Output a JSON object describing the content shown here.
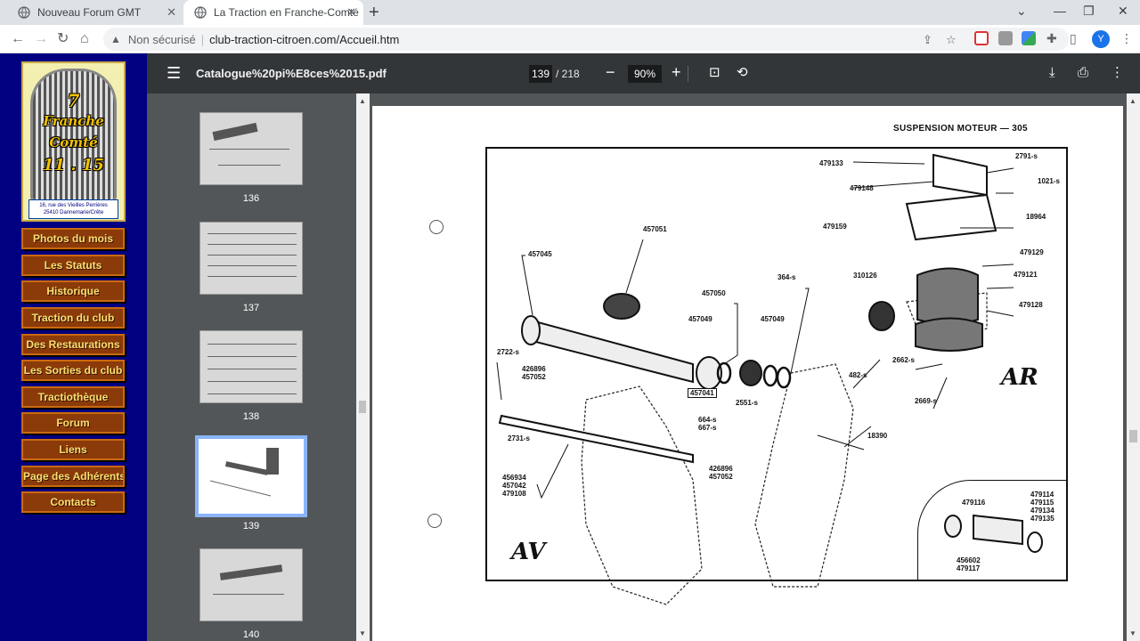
{
  "browser": {
    "tabs": [
      {
        "title": "Nouveau Forum GMT",
        "active": false
      },
      {
        "title": "La Traction en Franche-Comté",
        "active": true
      }
    ],
    "security_label": "Non sécurisé",
    "url": "club-traction-citroen.com/Accueil.htm",
    "profile_initial": "Y"
  },
  "site": {
    "logo": {
      "line1": "7",
      "line2": "Franche",
      "line3": "Comté",
      "line4": "11 . 15",
      "address1": "16, rue des Vieilles Perrières",
      "address2": "25410 Dannemarie/Crête"
    },
    "menu": [
      "Photos du mois",
      "Les Statuts",
      "Historique",
      "Traction du club",
      "Des Restaurations",
      "Les Sorties du club",
      "Tractiothèque",
      "Forum",
      "Liens",
      "Page des Adhérents",
      "Contacts"
    ],
    "colors": {
      "background": "#000080",
      "button": "#8b3a0a",
      "button_text": "#f7e070"
    }
  },
  "pdf": {
    "filename": "Catalogue%20pi%E8ces%2015.pdf",
    "current_page": "139",
    "total_pages": "/ 218",
    "zoom": "90%",
    "thumbnails": [
      {
        "page": "136",
        "selected": false
      },
      {
        "page": "137",
        "selected": false
      },
      {
        "page": "138",
        "selected": false
      },
      {
        "page": "139",
        "selected": true
      },
      {
        "page": "140",
        "selected": false
      }
    ],
    "page_content": {
      "header": "SUSPENSION MOTEUR — 305",
      "front_label": "AV",
      "rear_label": "AR",
      "part_labels": [
        "479133",
        "2791-s",
        "479148",
        "1021-s",
        "479159",
        "18964",
        "479129",
        "457051",
        "457045",
        "310126",
        "479121",
        "364-s",
        "457050",
        "479128",
        "457049",
        "457049",
        "2662-s",
        "482-s",
        "2722-s",
        "426896",
        "457052",
        "457041",
        "2669-s",
        "2551-s",
        "664-s",
        "667-s",
        "18390",
        "2731-s",
        "426896",
        "457052",
        "456934",
        "457042",
        "479108",
        "479116",
        "479114",
        "479115",
        "479134",
        "479135",
        "456602",
        "479117"
      ]
    }
  }
}
